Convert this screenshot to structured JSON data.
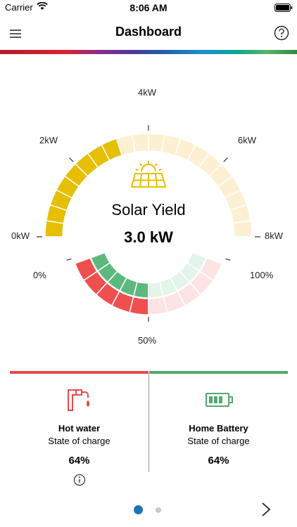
{
  "status_bar": {
    "carrier": "Carrier",
    "time": "8:06 AM"
  },
  "nav": {
    "title": "Dashboard",
    "menu_icon": "hamburger-menu-icon",
    "help_icon": "help-circle-icon"
  },
  "solar_gauge": {
    "labels": [
      "0kW",
      "2kW",
      "4kW",
      "6kW",
      "8kW"
    ],
    "min": 0,
    "max": 8,
    "value": 3.0,
    "title": "Solar Yield",
    "value_text": "3.0 kW",
    "colors": {
      "filled": "#e6bf00",
      "empty": "#fdf0d2"
    }
  },
  "self_consumption_gauge": {
    "labels": [
      "0%",
      "50%",
      "100%"
    ],
    "consumption_fraction": 0.5,
    "autarky_fraction": 0.5,
    "colors": {
      "red": "#f04f50",
      "red_empty": "#fde3e3",
      "green": "#5cb87c",
      "green_empty": "#e3f4e8"
    }
  },
  "cards": {
    "hot_water": {
      "title": "Hot water",
      "subtitle": "State of charge",
      "value": "64%",
      "icon": "faucet-icon",
      "accent": "#e84a4a"
    },
    "home_battery": {
      "title": "Home Battery",
      "subtitle": "State of charge",
      "value": "64%",
      "icon": "battery-icon",
      "accent": "#55a86f"
    }
  },
  "pager": {
    "current_page": 1,
    "total_pages": 2
  }
}
